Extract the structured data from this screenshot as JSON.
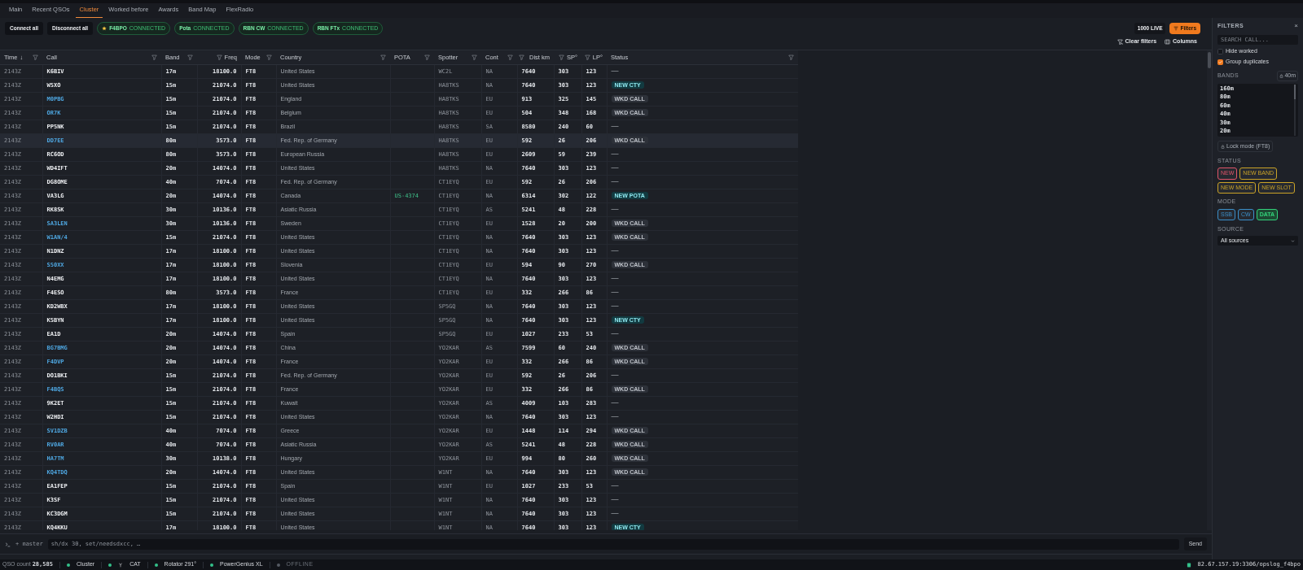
{
  "tabs": [
    {
      "label": "Main",
      "selected": false
    },
    {
      "label": "Recent QSOs",
      "selected": false
    },
    {
      "label": "Cluster",
      "selected": true
    },
    {
      "label": "Worked before",
      "selected": false
    },
    {
      "label": "Awards",
      "selected": false
    },
    {
      "label": "Band Map",
      "selected": false
    },
    {
      "label": "FlexRadio",
      "selected": false
    }
  ],
  "toolbar": {
    "buttons": [
      "Connect all",
      "Disconnect all"
    ],
    "connections": [
      {
        "name": "F4BPO",
        "starred": true,
        "state": "CONNECTED",
        "connected": true
      },
      {
        "name": "Pota",
        "starred": false,
        "state": "CONNECTED",
        "connected": true
      },
      {
        "name": "RBN CW",
        "starred": false,
        "state": "CONNECTED",
        "connected": true
      },
      {
        "name": "RBN FTx",
        "starred": false,
        "state": "CONNECTED",
        "connected": true
      }
    ],
    "live_count": "1000 LIVE",
    "filters_button": "Filters",
    "filters_open": true,
    "clear_filters": "Clear filters",
    "columns": "Columns"
  },
  "table": {
    "columns": [
      {
        "label": "Time",
        "sort": "↓"
      },
      {
        "label": "Call"
      },
      {
        "label": "Band"
      },
      {
        "label": "Freq"
      },
      {
        "label": "Mode"
      },
      {
        "label": "Country"
      },
      {
        "label": "POTA"
      },
      {
        "label": "Spotter"
      },
      {
        "label": "Cont"
      },
      {
        "label": "Dist km"
      },
      {
        "label": "SP°"
      },
      {
        "label": "LP°"
      },
      {
        "label": "Status"
      }
    ],
    "rows": [
      {
        "time": "2143Z",
        "call": "K6BIV",
        "worked": false,
        "band": "17m",
        "freq": "18100.0",
        "mode": "FT8",
        "country": "United States",
        "spotter": "WC2L",
        "cont": "NA",
        "dist": "7640",
        "sp": "303",
        "lp": "123",
        "status": {
          "text": "—",
          "kind": "none"
        },
        "selected": false
      },
      {
        "time": "2143Z",
        "call": "W5XO",
        "worked": false,
        "band": "15m",
        "freq": "21074.0",
        "mode": "FT8",
        "country": "United States",
        "spotter": "HA8TKS",
        "cont": "NA",
        "dist": "7640",
        "sp": "303",
        "lp": "123",
        "status": {
          "text": "NEW CTY",
          "kind": "new"
        },
        "selected": false
      },
      {
        "time": "2143Z",
        "call": "M0PBG",
        "worked": true,
        "band": "15m",
        "freq": "21074.0",
        "mode": "FT8",
        "country": "England",
        "spotter": "HA8TKS",
        "cont": "EU",
        "dist": "913",
        "sp": "325",
        "lp": "145",
        "status": {
          "text": "WKD CALL",
          "kind": "worked"
        },
        "selected": false
      },
      {
        "time": "2143Z",
        "call": "OR7K",
        "worked": true,
        "band": "15m",
        "freq": "21074.0",
        "mode": "FT8",
        "country": "Belgium",
        "spotter": "HA8TKS",
        "cont": "EU",
        "dist": "504",
        "sp": "348",
        "lp": "168",
        "status": {
          "text": "WKD CALL",
          "kind": "worked"
        },
        "selected": false
      },
      {
        "time": "2143Z",
        "call": "PP5NK",
        "worked": false,
        "band": "15m",
        "freq": "21074.0",
        "mode": "FT8",
        "country": "Brazil",
        "spotter": "HA8TKS",
        "cont": "SA",
        "dist": "8580",
        "sp": "240",
        "lp": "60",
        "status": {
          "text": "—",
          "kind": "none"
        },
        "selected": false
      },
      {
        "time": "2143Z",
        "call": "DD7EE",
        "worked": true,
        "band": "80m",
        "freq": "3573.0",
        "mode": "FT8",
        "country": "Fed. Rep. of Germany",
        "spotter": "HA8TKS",
        "cont": "EU",
        "dist": "592",
        "sp": "26",
        "lp": "206",
        "status": {
          "text": "WKD CALL",
          "kind": "worked"
        },
        "selected": true
      },
      {
        "time": "2143Z",
        "call": "RC6OD",
        "worked": false,
        "band": "80m",
        "freq": "3573.0",
        "mode": "FT8",
        "country": "European Russia",
        "spotter": "HA8TKS",
        "cont": "EU",
        "dist": "2609",
        "sp": "59",
        "lp": "239",
        "status": {
          "text": "—",
          "kind": "none"
        },
        "selected": false
      },
      {
        "time": "2143Z",
        "call": "WD4IFT",
        "worked": false,
        "band": "20m",
        "freq": "14074.0",
        "mode": "FT8",
        "country": "United States",
        "spotter": "HA8TKS",
        "cont": "NA",
        "dist": "7640",
        "sp": "303",
        "lp": "123",
        "status": {
          "text": "—",
          "kind": "none"
        },
        "selected": false
      },
      {
        "time": "2143Z",
        "call": "DG8OME",
        "worked": false,
        "band": "40m",
        "freq": "7074.0",
        "mode": "FT8",
        "country": "Fed. Rep. of Germany",
        "spotter": "CT1EYQ",
        "cont": "EU",
        "dist": "592",
        "sp": "26",
        "lp": "206",
        "status": {
          "text": "—",
          "kind": "none"
        },
        "selected": false
      },
      {
        "time": "2143Z",
        "call": "VA3LG",
        "worked": false,
        "band": "20m",
        "freq": "14074.0",
        "mode": "FT8",
        "country": "Canada",
        "pota": "US-4374",
        "spotter": "CT1EYQ",
        "cont": "NA",
        "dist": "6314",
        "sp": "302",
        "lp": "122",
        "status": {
          "text": "NEW POTA",
          "kind": "new"
        },
        "selected": false
      },
      {
        "time": "2143Z",
        "call": "RK8SK",
        "worked": false,
        "band": "30m",
        "freq": "10136.0",
        "mode": "FT8",
        "country": "Asiatic Russia",
        "spotter": "CT1EYQ",
        "cont": "AS",
        "dist": "5241",
        "sp": "48",
        "lp": "228",
        "status": {
          "text": "—",
          "kind": "none"
        },
        "selected": false
      },
      {
        "time": "2143Z",
        "call": "SA3LEN",
        "worked": true,
        "band": "30m",
        "freq": "10136.0",
        "mode": "FT8",
        "country": "Sweden",
        "spotter": "CT1EYQ",
        "cont": "EU",
        "dist": "1528",
        "sp": "20",
        "lp": "200",
        "status": {
          "text": "WKD CALL",
          "kind": "worked"
        },
        "selected": false
      },
      {
        "time": "2143Z",
        "call": "W1AN/4",
        "worked": true,
        "band": "15m",
        "freq": "21074.0",
        "mode": "FT8",
        "country": "United States",
        "spotter": "CT1EYQ",
        "cont": "NA",
        "dist": "7640",
        "sp": "303",
        "lp": "123",
        "status": {
          "text": "WKD CALL",
          "kind": "worked"
        },
        "selected": false
      },
      {
        "time": "2143Z",
        "call": "N1DNZ",
        "worked": false,
        "band": "17m",
        "freq": "18100.0",
        "mode": "FT8",
        "country": "United States",
        "spotter": "CT1EYQ",
        "cont": "NA",
        "dist": "7640",
        "sp": "303",
        "lp": "123",
        "status": {
          "text": "—",
          "kind": "none"
        },
        "selected": false
      },
      {
        "time": "2143Z",
        "call": "S50XX",
        "worked": true,
        "band": "17m",
        "freq": "18100.0",
        "mode": "FT8",
        "country": "Slovenia",
        "spotter": "CT1EYQ",
        "cont": "EU",
        "dist": "594",
        "sp": "90",
        "lp": "270",
        "status": {
          "text": "WKD CALL",
          "kind": "worked"
        },
        "selected": false
      },
      {
        "time": "2143Z",
        "call": "N4EMG",
        "worked": false,
        "band": "17m",
        "freq": "18100.0",
        "mode": "FT8",
        "country": "United States",
        "spotter": "CT1EYQ",
        "cont": "NA",
        "dist": "7640",
        "sp": "303",
        "lp": "123",
        "status": {
          "text": "—",
          "kind": "none"
        },
        "selected": false
      },
      {
        "time": "2143Z",
        "call": "F4ESO",
        "worked": false,
        "band": "80m",
        "freq": "3573.0",
        "mode": "FT8",
        "country": "France",
        "spotter": "CT1EYQ",
        "cont": "EU",
        "dist": "332",
        "sp": "266",
        "lp": "86",
        "status": {
          "text": "—",
          "kind": "none"
        },
        "selected": false
      },
      {
        "time": "2143Z",
        "call": "KD2WBX",
        "worked": false,
        "band": "17m",
        "freq": "18100.0",
        "mode": "FT8",
        "country": "United States",
        "spotter": "SP5GQ",
        "cont": "NA",
        "dist": "7640",
        "sp": "303",
        "lp": "123",
        "status": {
          "text": "—",
          "kind": "none"
        },
        "selected": false
      },
      {
        "time": "2143Z",
        "call": "K5BYN",
        "worked": false,
        "band": "17m",
        "freq": "18100.0",
        "mode": "FT8",
        "country": "United States",
        "spotter": "SP5GQ",
        "cont": "NA",
        "dist": "7640",
        "sp": "303",
        "lp": "123",
        "status": {
          "text": "NEW CTY",
          "kind": "new"
        },
        "selected": false
      },
      {
        "time": "2143Z",
        "call": "EA1D",
        "worked": false,
        "band": "20m",
        "freq": "14074.0",
        "mode": "FT8",
        "country": "Spain",
        "spotter": "SP5GQ",
        "cont": "EU",
        "dist": "1027",
        "sp": "233",
        "lp": "53",
        "status": {
          "text": "—",
          "kind": "none"
        },
        "selected": false
      },
      {
        "time": "2143Z",
        "call": "BG7BMG",
        "worked": true,
        "band": "20m",
        "freq": "14074.0",
        "mode": "FT8",
        "country": "China",
        "spotter": "YO2KAR",
        "cont": "AS",
        "dist": "7599",
        "sp": "60",
        "lp": "240",
        "status": {
          "text": "WKD CALL",
          "kind": "worked"
        },
        "selected": false
      },
      {
        "time": "2143Z",
        "call": "F4DVP",
        "worked": true,
        "band": "20m",
        "freq": "14074.0",
        "mode": "FT8",
        "country": "France",
        "spotter": "YO2KAR",
        "cont": "EU",
        "dist": "332",
        "sp": "266",
        "lp": "86",
        "status": {
          "text": "WKD CALL",
          "kind": "worked"
        },
        "selected": false
      },
      {
        "time": "2143Z",
        "call": "DO1BKI",
        "worked": false,
        "band": "15m",
        "freq": "21074.0",
        "mode": "FT8",
        "country": "Fed. Rep. of Germany",
        "spotter": "YO2KAR",
        "cont": "EU",
        "dist": "592",
        "sp": "26",
        "lp": "206",
        "status": {
          "text": "—",
          "kind": "none"
        },
        "selected": false
      },
      {
        "time": "2143Z",
        "call": "F4BQS",
        "worked": true,
        "band": "15m",
        "freq": "21074.0",
        "mode": "FT8",
        "country": "France",
        "spotter": "YO2KAR",
        "cont": "EU",
        "dist": "332",
        "sp": "266",
        "lp": "86",
        "status": {
          "text": "WKD CALL",
          "kind": "worked"
        },
        "selected": false
      },
      {
        "time": "2143Z",
        "call": "9K2ET",
        "worked": false,
        "band": "15m",
        "freq": "21074.0",
        "mode": "FT8",
        "country": "Kuwait",
        "spotter": "YO2KAR",
        "cont": "AS",
        "dist": "4009",
        "sp": "103",
        "lp": "283",
        "status": {
          "text": "—",
          "kind": "none"
        },
        "selected": false
      },
      {
        "time": "2143Z",
        "call": "W2HDI",
        "worked": false,
        "band": "15m",
        "freq": "21074.0",
        "mode": "FT8",
        "country": "United States",
        "spotter": "YO2KAR",
        "cont": "NA",
        "dist": "7640",
        "sp": "303",
        "lp": "123",
        "status": {
          "text": "—",
          "kind": "none"
        },
        "selected": false
      },
      {
        "time": "2143Z",
        "call": "SV1DZB",
        "worked": true,
        "band": "40m",
        "freq": "7074.0",
        "mode": "FT8",
        "country": "Greece",
        "spotter": "YO2KAR",
        "cont": "EU",
        "dist": "1448",
        "sp": "114",
        "lp": "294",
        "status": {
          "text": "WKD CALL",
          "kind": "worked"
        },
        "selected": false
      },
      {
        "time": "2143Z",
        "call": "RV0AR",
        "worked": true,
        "band": "40m",
        "freq": "7074.0",
        "mode": "FT8",
        "country": "Asiatic Russia",
        "spotter": "YO2KAR",
        "cont": "AS",
        "dist": "5241",
        "sp": "48",
        "lp": "228",
        "status": {
          "text": "WKD CALL",
          "kind": "worked"
        },
        "selected": false
      },
      {
        "time": "2143Z",
        "call": "HA7TM",
        "worked": true,
        "band": "30m",
        "freq": "10138.0",
        "mode": "FT8",
        "country": "Hungary",
        "spotter": "YO2KAR",
        "cont": "EU",
        "dist": "994",
        "sp": "80",
        "lp": "260",
        "status": {
          "text": "WKD CALL",
          "kind": "worked"
        },
        "selected": false
      },
      {
        "time": "2143Z",
        "call": "KQ4TDQ",
        "worked": true,
        "band": "20m",
        "freq": "14074.0",
        "mode": "FT8",
        "country": "United States",
        "spotter": "W1NT",
        "cont": "NA",
        "dist": "7640",
        "sp": "303",
        "lp": "123",
        "status": {
          "text": "WKD CALL",
          "kind": "worked"
        },
        "selected": false
      },
      {
        "time": "2143Z",
        "call": "EA1FEP",
        "worked": false,
        "band": "15m",
        "freq": "21074.0",
        "mode": "FT8",
        "country": "Spain",
        "spotter": "W1NT",
        "cont": "EU",
        "dist": "1027",
        "sp": "233",
        "lp": "53",
        "status": {
          "text": "—",
          "kind": "none"
        },
        "selected": false
      },
      {
        "time": "2143Z",
        "call": "K3SF",
        "worked": false,
        "band": "15m",
        "freq": "21074.0",
        "mode": "FT8",
        "country": "United States",
        "spotter": "W1NT",
        "cont": "NA",
        "dist": "7640",
        "sp": "303",
        "lp": "123",
        "status": {
          "text": "—",
          "kind": "none"
        },
        "selected": false
      },
      {
        "time": "2143Z",
        "call": "KC3DGM",
        "worked": false,
        "band": "15m",
        "freq": "21074.0",
        "mode": "FT8",
        "country": "United States",
        "spotter": "W1NT",
        "cont": "NA",
        "dist": "7640",
        "sp": "303",
        "lp": "123",
        "status": {
          "text": "—",
          "kind": "none"
        },
        "selected": false
      },
      {
        "time": "2143Z",
        "call": "KQ4KKU",
        "worked": false,
        "band": "17m",
        "freq": "18100.0",
        "mode": "FT8",
        "country": "United States",
        "spotter": "W1NT",
        "cont": "NA",
        "dist": "7640",
        "sp": "303",
        "lp": "123",
        "status": {
          "text": "NEW CTY",
          "kind": "new"
        },
        "selected": false
      }
    ]
  },
  "filters": {
    "title": "FILTERS",
    "close": "×",
    "search_placeholder": "SEARCH CALL...",
    "checkboxes": [
      {
        "label": "Hide worked",
        "checked": false
      },
      {
        "label": "Group duplicates",
        "checked": true
      }
    ],
    "bands_label": "BANDS",
    "band_button": "40m",
    "bands": [
      "160m",
      "80m",
      "60m",
      "40m",
      "30m",
      "20m"
    ],
    "lock_mode": "Lock mode (FT8)",
    "status_label": "STATUS",
    "status_chips": [
      {
        "label": "NEW",
        "color": "#e0556a",
        "selected": false
      },
      {
        "label": "NEW BAND",
        "color": "#c9a227",
        "selected": false
      },
      {
        "label": "NEW MODE",
        "color": "#c9a227",
        "selected": false
      },
      {
        "label": "NEW SLOT",
        "color": "#c9a227",
        "selected": false
      }
    ],
    "mode_label": "MODE",
    "mode_chips": [
      {
        "label": "SSB",
        "color": "#3b8fc9",
        "selected": false
      },
      {
        "label": "CW",
        "color": "#3b8fc9",
        "selected": false
      },
      {
        "label": "DATA",
        "color": "#33d17a",
        "selected": true
      }
    ],
    "source_label": "SOURCE",
    "source_value": "All sources"
  },
  "command_bar": {
    "branch": "+ master",
    "placeholder": "sh/dx 30, set/needsdxcc, …",
    "send": "Send"
  },
  "status_bar": {
    "qso_label": "QSO count",
    "qso_count": "28,585",
    "items": [
      {
        "label": "Cluster",
        "kind": "plain",
        "online": true
      },
      {
        "label": "CAT",
        "kind": "radio",
        "online": true
      },
      {
        "label": "Rotator 291°",
        "kind": "plain",
        "online": true
      },
      {
        "label": "PowerGenius XL",
        "kind": "plain",
        "online": true
      },
      {
        "label": "OFFLINE",
        "kind": "plain",
        "online": false
      }
    ],
    "database": "82.67.157.19:3306/opslog_f4bpo"
  }
}
